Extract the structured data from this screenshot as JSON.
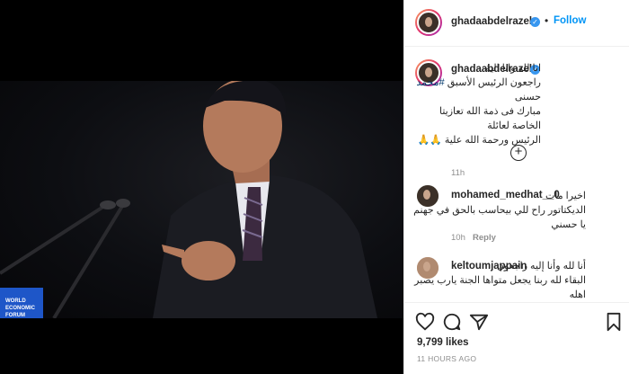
{
  "post": {
    "author": "ghadaabdelrazek",
    "verified_mark": "✓",
    "dot": "•",
    "follow_label": "Follow"
  },
  "caption": {
    "author": "ghadaabdelrazek",
    "line1": "انا لله وانا الية",
    "line2_pre": "راجعون الرئيس الأسبق",
    "hashtag": "#محمد",
    "line2_post": "حسنى",
    "line3": "مبارك فى ذمة الله تعازيتا الخاصة لعائلة",
    "line4": "الرئيس ورحمة الله علية 🙏🙏",
    "time": "11h"
  },
  "load_more_icon": "plus-circle-icon",
  "load_more_symbol": "+",
  "comments": [
    {
      "author": "mohamed_medhat__0",
      "line1": "اخيرا مات",
      "line2": "الديكتاتور راح للي بيحاسب بالحق في جهنم",
      "line3": "يا حسني",
      "time": "10h",
      "reply": "Reply"
    },
    {
      "author": "keltoumjappain",
      "line1": "أنا لله وأنا إليه راجعون",
      "line2": "البقاء لله ربنا يجعل متواها الجنة يارب يصبر",
      "line3": "اهله",
      "time": "",
      "reply": ""
    }
  ],
  "actions": {
    "icons": [
      "heart-icon",
      "comment-icon",
      "share-icon",
      "bookmark-icon"
    ],
    "likes": "9,799 likes",
    "ago": "11 HOURS AGO"
  },
  "colors": {
    "link": "#0095f6",
    "text": "#262626",
    "muted": "#8e8e8e",
    "backdrop": "#000000"
  }
}
